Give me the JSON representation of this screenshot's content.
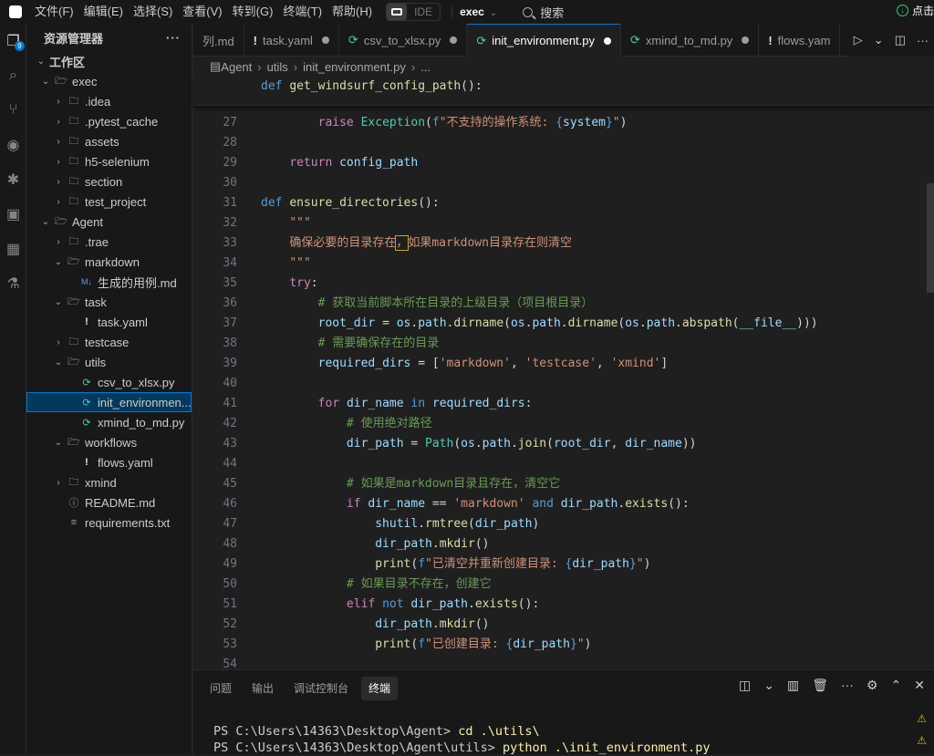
{
  "menubar": {
    "items": [
      "文件(F)",
      "编辑(E)",
      "选择(S)",
      "查看(V)",
      "转到(G)",
      "终端(T)",
      "帮助(H)"
    ],
    "ide_label": "IDE",
    "workspace": "exec",
    "search": "搜索",
    "right_action": "点击"
  },
  "activity": {
    "badge": "9"
  },
  "explorer": {
    "title": "资源管理器",
    "section": "工作区",
    "tree": [
      {
        "label": "exec",
        "depth": 0,
        "type": "folder",
        "open": true
      },
      {
        "label": ".idea",
        "depth": 1,
        "type": "folder"
      },
      {
        "label": ".pytest_cache",
        "depth": 1,
        "type": "folder"
      },
      {
        "label": "assets",
        "depth": 1,
        "type": "folder"
      },
      {
        "label": "h5-selenium",
        "depth": 1,
        "type": "folder"
      },
      {
        "label": "section",
        "depth": 1,
        "type": "folder"
      },
      {
        "label": "test_project",
        "depth": 1,
        "type": "folder"
      },
      {
        "label": "Agent",
        "depth": 0,
        "type": "folder",
        "open": true
      },
      {
        "label": ".trae",
        "depth": 1,
        "type": "folder"
      },
      {
        "label": "markdown",
        "depth": 1,
        "type": "folder",
        "open": true
      },
      {
        "label": "生成的用例.md",
        "depth": 2,
        "type": "md"
      },
      {
        "label": "task",
        "depth": 1,
        "type": "folder",
        "open": true
      },
      {
        "label": "task.yaml",
        "depth": 2,
        "type": "yaml"
      },
      {
        "label": "testcase",
        "depth": 1,
        "type": "folder"
      },
      {
        "label": "utils",
        "depth": 1,
        "type": "folder",
        "open": true
      },
      {
        "label": "csv_to_xlsx.py",
        "depth": 2,
        "type": "py"
      },
      {
        "label": "init_environmen...",
        "depth": 2,
        "type": "py",
        "selected": true
      },
      {
        "label": "xmind_to_md.py",
        "depth": 2,
        "type": "py"
      },
      {
        "label": "workflows",
        "depth": 1,
        "type": "folder",
        "open": true
      },
      {
        "label": "flows.yaml",
        "depth": 2,
        "type": "yaml"
      },
      {
        "label": "xmind",
        "depth": 1,
        "type": "folder"
      },
      {
        "label": "README.md",
        "depth": 1,
        "type": "info"
      },
      {
        "label": "requirements.txt",
        "depth": 1,
        "type": "txt"
      }
    ]
  },
  "tabs": [
    {
      "label": "列.md",
      "kind": "md",
      "dirty": false
    },
    {
      "label": "task.yaml",
      "kind": "yaml",
      "dirty": true
    },
    {
      "label": "csv_to_xlsx.py",
      "kind": "py",
      "dirty": true
    },
    {
      "label": "init_environment.py",
      "kind": "py",
      "dirty": true,
      "active": true
    },
    {
      "label": "xmind_to_md.py",
      "kind": "py",
      "dirty": true
    },
    {
      "label": "flows.yam",
      "kind": "yaml",
      "dirty": false
    }
  ],
  "breadcrumb": [
    "Agent",
    "utils",
    "init_environment.py",
    "..."
  ],
  "sticky": "def get_windsurf_config_path():",
  "code": [
    {
      "n": "27",
      "t": "        raise Exception(f\"不支持的操作系统: {system}\")"
    },
    {
      "n": "28",
      "t": ""
    },
    {
      "n": "29",
      "t": "    return config_path"
    },
    {
      "n": "30",
      "t": ""
    },
    {
      "n": "31",
      "t": "def ensure_directories():"
    },
    {
      "n": "32",
      "t": "    \"\"\""
    },
    {
      "n": "33",
      "t": "    确保必要的目录存在，如果markdown目录存在则清空"
    },
    {
      "n": "34",
      "t": "    \"\"\""
    },
    {
      "n": "35",
      "t": "    try:"
    },
    {
      "n": "36",
      "t": "        # 获取当前脚本所在目录的上级目录（项目根目录）"
    },
    {
      "n": "37",
      "t": "        root_dir = os.path.dirname(os.path.dirname(os.path.abspath(__file__)))"
    },
    {
      "n": "38",
      "t": "        # 需要确保存在的目录"
    },
    {
      "n": "39",
      "t": "        required_dirs = ['markdown', 'testcase', 'xmind']"
    },
    {
      "n": "40",
      "t": ""
    },
    {
      "n": "41",
      "t": "        for dir_name in required_dirs:"
    },
    {
      "n": "42",
      "t": "            # 使用绝对路径"
    },
    {
      "n": "43",
      "t": "            dir_path = Path(os.path.join(root_dir, dir_name))"
    },
    {
      "n": "44",
      "t": ""
    },
    {
      "n": "45",
      "t": "            # 如果是markdown目录且存在，清空它"
    },
    {
      "n": "46",
      "t": "            if dir_name == 'markdown' and dir_path.exists():"
    },
    {
      "n": "47",
      "t": "                shutil.rmtree(dir_path)"
    },
    {
      "n": "48",
      "t": "                dir_path.mkdir()"
    },
    {
      "n": "49",
      "t": "                print(f\"已清空并重新创建目录: {dir_path}\")"
    },
    {
      "n": "50",
      "t": "            # 如果目录不存在，创建它"
    },
    {
      "n": "51",
      "t": "            elif not dir_path.exists():"
    },
    {
      "n": "52",
      "t": "                dir_path.mkdir()"
    },
    {
      "n": "53",
      "t": "                print(f\"已创建目录: {dir_path}\")"
    },
    {
      "n": "54",
      "t": ""
    }
  ],
  "panel": {
    "tabs": [
      "问题",
      "输出",
      "调试控制台",
      "终端"
    ],
    "active_tab": "终端",
    "terminal": [
      {
        "prompt": "PS C:\\Users\\14363\\Desktop\\Agent> ",
        "cmd": "cd .\\utils\\"
      },
      {
        "prompt": "PS C:\\Users\\14363\\Desktop\\Agent\\utils> ",
        "cmd": "python .\\init_environment.py"
      }
    ]
  }
}
